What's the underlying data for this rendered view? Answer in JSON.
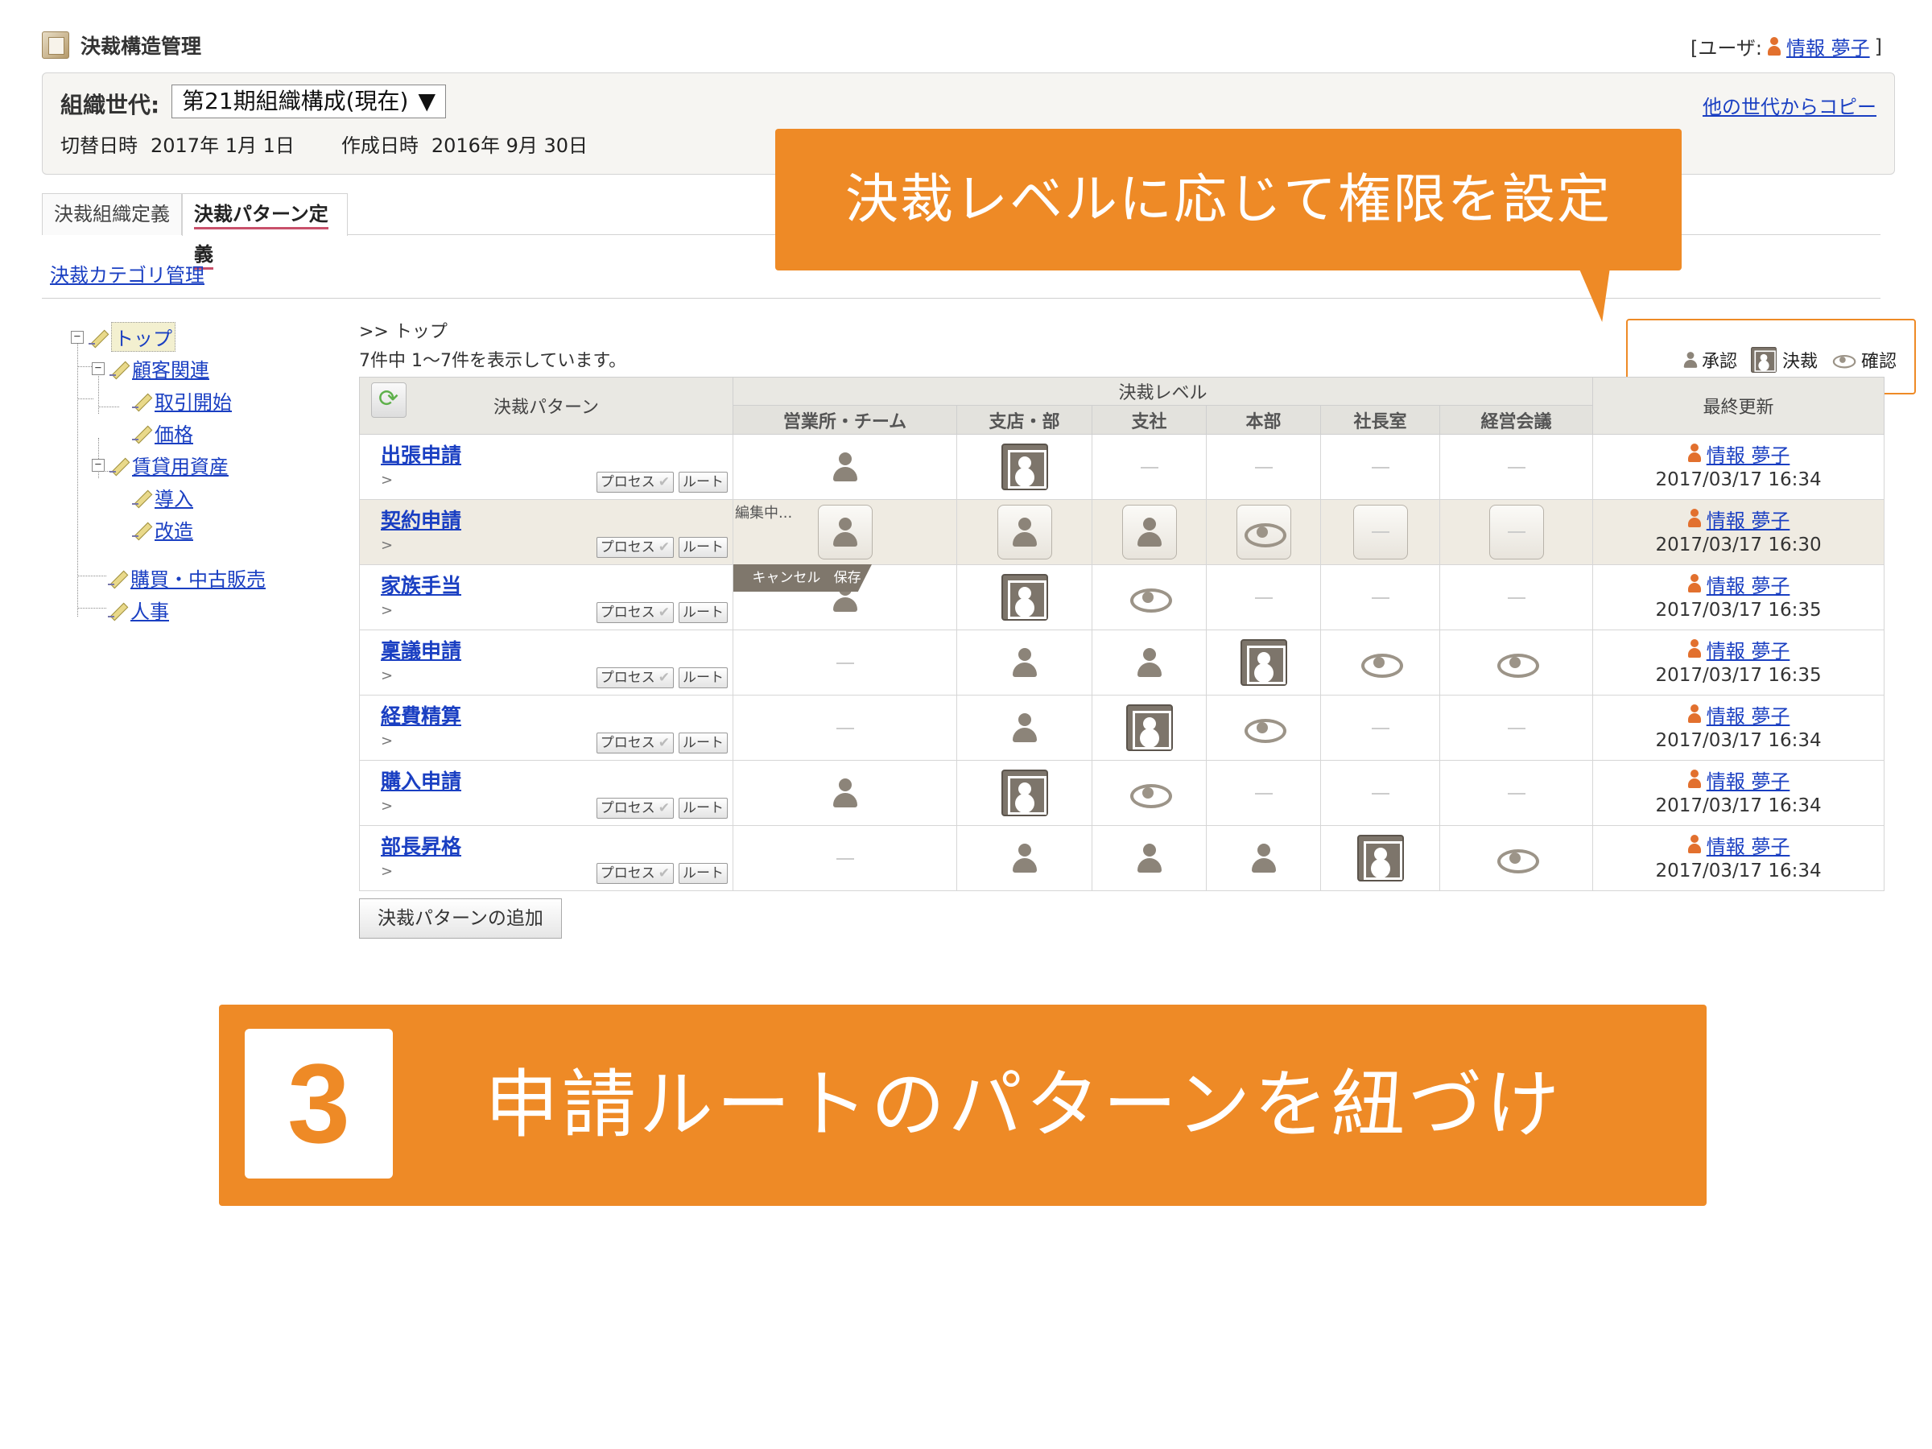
{
  "header": {
    "app_title": "決裁構造管理",
    "user_prefix": "[ユーザ:",
    "user_name": "情報 夢子",
    "user_suffix": "]"
  },
  "org": {
    "label": "組織世代:",
    "select_value": "第21期組織構成(現在)",
    "switch_label": "切替日時",
    "switch_date": "2017年 1月 1日",
    "created_label": "作成日時",
    "created_date": "2016年 9月 30日",
    "copy_link": "他の世代からコピー"
  },
  "tabs": [
    "決裁組織定義",
    "決裁パターン定義"
  ],
  "category_link": "決裁カテゴリ管理",
  "tree": {
    "root": "トップ",
    "n1": "顧客関連",
    "n1a": "取引開始",
    "n1b": "価格",
    "n2": "賃貸用資産",
    "n2a": "導入",
    "n2b": "改造",
    "n3": "購買・中古販売",
    "n4": "人事"
  },
  "breadcrumb": ">> トップ",
  "count_text": "7件中 1〜7件を表示しています。",
  "legend": {
    "approve": "承認",
    "decide": "決裁",
    "confirm": "確認"
  },
  "table": {
    "col_pattern": "決裁パターン",
    "col_level": "決裁レベル",
    "col_updated": "最終更新",
    "levels": [
      "営業所・チーム",
      "支店・部",
      "支社",
      "本部",
      "社長室",
      "経営会議"
    ],
    "process_btn": "プロセス",
    "route_btn": "ルート",
    "arrow": ">",
    "editing_label": "編集中...",
    "cancel": "キャンセル",
    "save": "保存",
    "rows": [
      {
        "name": "出張申請",
        "user": "情報 夢子",
        "time": "2017/03/17 16:34"
      },
      {
        "name": "契約申請",
        "user": "情報 夢子",
        "time": "2017/03/17 16:30"
      },
      {
        "name": "家族手当",
        "user": "情報 夢子",
        "time": "2017/03/17 16:35"
      },
      {
        "name": "稟議申請",
        "user": "情報 夢子",
        "time": "2017/03/17 16:35"
      },
      {
        "name": "経費精算",
        "user": "情報 夢子",
        "time": "2017/03/17 16:34"
      },
      {
        "name": "購入申請",
        "user": "情報 夢子",
        "time": "2017/03/17 16:34"
      },
      {
        "name": "部長昇格",
        "user": "情報 夢子",
        "time": "2017/03/17 16:34"
      }
    ]
  },
  "add_button": "決裁パターンの追加",
  "callout_top": "決裁レベルに応じて権限を設定",
  "banner": {
    "number": "3",
    "text": "申請ルートのパターンを紐づけ"
  },
  "colors": {
    "accent": "#ee8a26",
    "link": "#1a3fc2"
  }
}
